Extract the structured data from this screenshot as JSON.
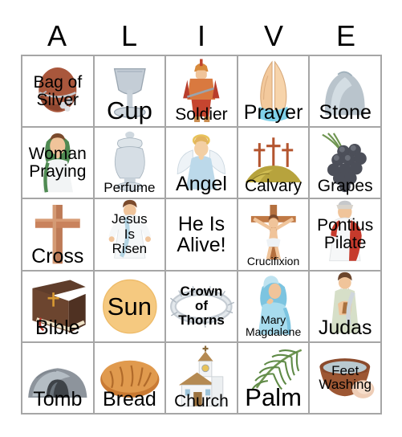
{
  "card": {
    "title_letters": [
      "A",
      "L",
      "I",
      "V",
      "E"
    ],
    "grid_line_color": "#a6a6a6",
    "background_color": "#ffffff",
    "text_color": "#000000",
    "columns": 5,
    "rows": 5
  },
  "cells": [
    {
      "label": "Bag of Silver",
      "lines": [
        "Bag of",
        "Silver"
      ],
      "icon": "money-bag-icon",
      "size": "md",
      "bold": false,
      "position": "center"
    },
    {
      "label": "Cup",
      "lines": [
        "Cup"
      ],
      "icon": "chalice-icon",
      "size": "xl",
      "bold": false,
      "position": "bottom"
    },
    {
      "label": "Soldier",
      "lines": [
        "Soldier"
      ],
      "icon": "roman-soldier-icon",
      "size": "md",
      "bold": false,
      "position": "bottom"
    },
    {
      "label": "Prayer",
      "lines": [
        "Prayer"
      ],
      "icon": "praying-hands-icon",
      "size": "lg",
      "bold": false,
      "position": "bottom"
    },
    {
      "label": "Stone",
      "lines": [
        "Stone"
      ],
      "icon": "rolling-stone-icon",
      "size": "lg",
      "bold": false,
      "position": "bottom"
    },
    {
      "label": "Woman Praying",
      "lines": [
        "Woman",
        "Praying"
      ],
      "icon": "woman-praying-icon",
      "size": "md",
      "bold": false,
      "position": "center"
    },
    {
      "label": "Perfume",
      "lines": [
        "Perfume"
      ],
      "icon": "alabaster-jar-icon",
      "size": "sm",
      "bold": false,
      "position": "bottom"
    },
    {
      "label": "Angel",
      "lines": [
        "Angel"
      ],
      "icon": "angel-icon",
      "size": "lg",
      "bold": false,
      "position": "bottom"
    },
    {
      "label": "Calvary",
      "lines": [
        "Calvary"
      ],
      "icon": "three-crosses-hill-icon",
      "size": "md",
      "bold": false,
      "position": "bottom"
    },
    {
      "label": "Grapes",
      "lines": [
        "Grapes"
      ],
      "icon": "grapes-icon",
      "size": "md",
      "bold": false,
      "position": "bottom"
    },
    {
      "label": "Cross",
      "lines": [
        "Cross"
      ],
      "icon": "wooden-cross-icon",
      "size": "lg",
      "bold": false,
      "position": "bottom"
    },
    {
      "label": "Jesus Is Risen",
      "lines": [
        "Jesus",
        "Is",
        "Risen"
      ],
      "icon": "risen-jesus-icon",
      "size": "sm",
      "bold": false,
      "position": "center"
    },
    {
      "label": "He Is Alive!",
      "lines": [
        "He Is",
        "Alive!"
      ],
      "icon": "none",
      "size": "lg",
      "bold": false,
      "position": "center"
    },
    {
      "label": "Crucifixion",
      "lines": [
        "Crucifixion"
      ],
      "icon": "crucifixion-icon",
      "size": "xs",
      "bold": false,
      "position": "bottom"
    },
    {
      "label": "Pontius Pilate",
      "lines": [
        "Pontius",
        "Pilate"
      ],
      "icon": "pontius-pilate-icon",
      "size": "md",
      "bold": false,
      "position": "center"
    },
    {
      "label": "Bible",
      "lines": [
        "Bible"
      ],
      "icon": "bible-icon",
      "size": "lg",
      "bold": false,
      "position": "bottom"
    },
    {
      "label": "Sun",
      "lines": [
        "Sun"
      ],
      "icon": "sun-icon",
      "size": "xl",
      "bold": false,
      "position": "center"
    },
    {
      "label": "Crown of Thorns",
      "lines": [
        "Crown",
        "of",
        "Thorns"
      ],
      "icon": "crown-of-thorns-icon",
      "size": "sm",
      "bold": true,
      "position": "center"
    },
    {
      "label": "Mary Magdalene",
      "lines": [
        "Mary",
        "Magdalene"
      ],
      "icon": "mary-magdalene-icon",
      "size": "xs",
      "bold": false,
      "position": "bottom"
    },
    {
      "label": "Judas",
      "lines": [
        "Judas"
      ],
      "icon": "judas-icon",
      "size": "lg",
      "bold": false,
      "position": "bottom"
    },
    {
      "label": "Tomb",
      "lines": [
        "Tomb"
      ],
      "icon": "empty-tomb-icon",
      "size": "lg",
      "bold": false,
      "position": "bottom"
    },
    {
      "label": "Bread",
      "lines": [
        "Bread"
      ],
      "icon": "bread-loaf-icon",
      "size": "lg",
      "bold": false,
      "position": "bottom"
    },
    {
      "label": "Church",
      "lines": [
        "Church"
      ],
      "icon": "church-icon",
      "size": "md",
      "bold": false,
      "position": "bottom"
    },
    {
      "label": "Palm",
      "lines": [
        "Palm"
      ],
      "icon": "palm-branch-icon",
      "size": "xl",
      "bold": false,
      "position": "bottom"
    },
    {
      "label": "Feet Washing",
      "lines": [
        "Feet",
        "Washing"
      ],
      "icon": "feet-washing-basin-icon",
      "size": "sm",
      "bold": false,
      "position": "center"
    }
  ]
}
